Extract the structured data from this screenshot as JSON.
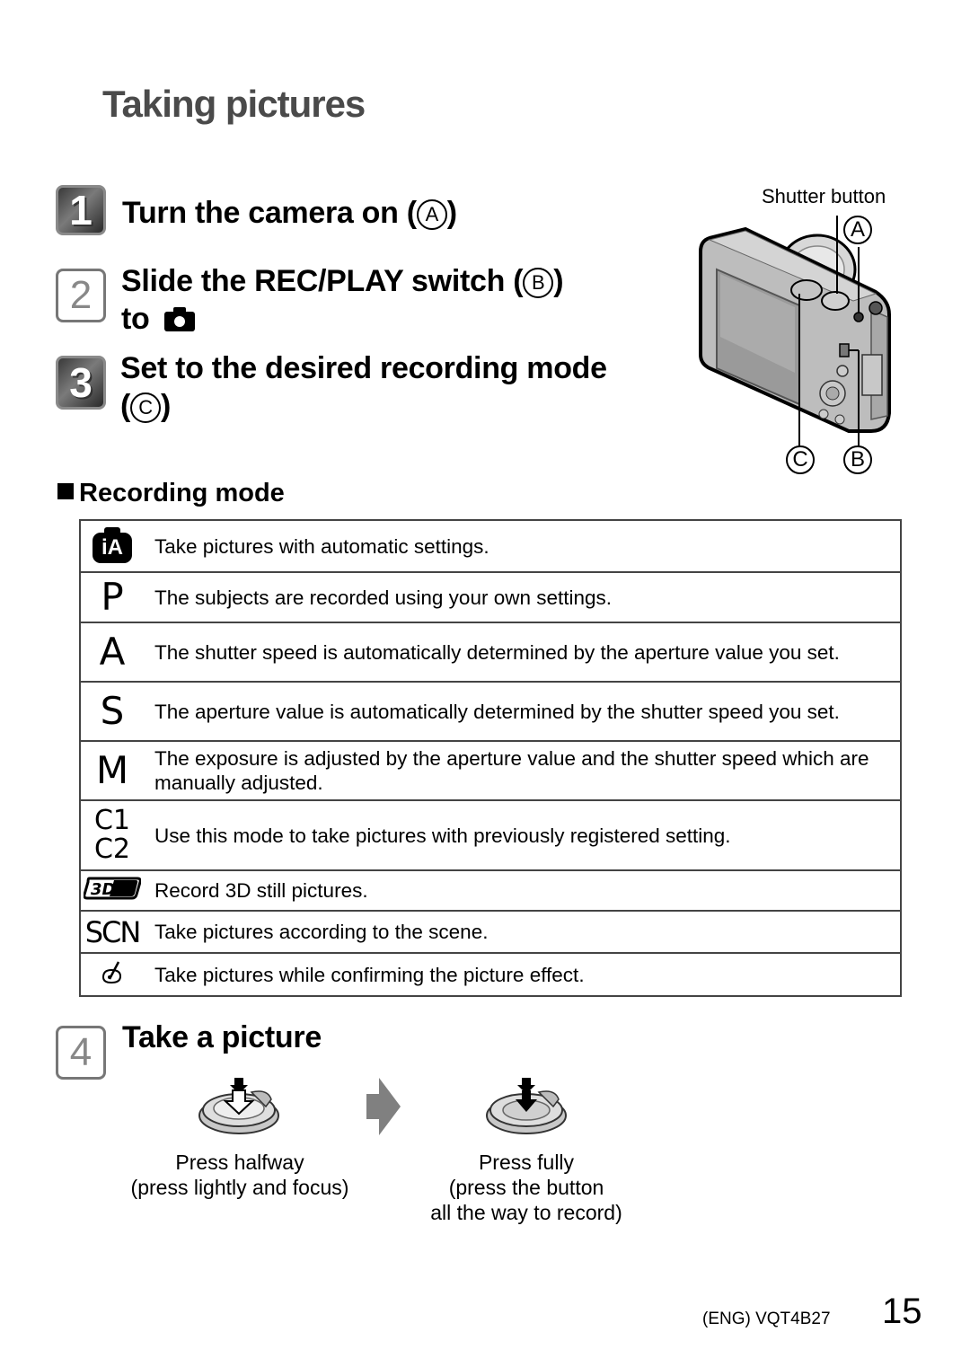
{
  "page_title": "Taking pictures",
  "steps": [
    {
      "number": "1",
      "line1": "Turn the camera on (",
      "marker": "A",
      "line1_end": ")"
    },
    {
      "number": "2",
      "line1": "Slide the REC/PLAY switch (",
      "marker": "B",
      "line1_end": ")",
      "line2": "to",
      "line2_icon": "camera-icon"
    },
    {
      "number": "3",
      "line1": "Set to the desired recording mode",
      "line2_open": "(",
      "marker": "C",
      "line2_end": ")"
    },
    {
      "number": "4",
      "line1": "Take a picture"
    }
  ],
  "camera_figure": {
    "shutter_label": "Shutter button",
    "markers": [
      "A",
      "B",
      "C"
    ]
  },
  "recording_mode": {
    "heading": "Recording mode",
    "rows": [
      {
        "icon": "intelligent-auto-icon",
        "glyph": "iA",
        "description": "Take pictures with automatic settings."
      },
      {
        "icon": "program-mode-icon",
        "glyph": "P",
        "description": "The subjects are recorded using your own settings."
      },
      {
        "icon": "aperture-priority-icon",
        "glyph": "A",
        "description": "The shutter speed is automatically determined by the aperture value you set."
      },
      {
        "icon": "shutter-priority-icon",
        "glyph": "S",
        "description": "The aperture value is automatically determined by the shutter speed you set."
      },
      {
        "icon": "manual-mode-icon",
        "glyph": "M",
        "description": "The exposure is adjusted by the aperture value and the shutter speed which are manually adjusted."
      },
      {
        "icon": "custom-mode-icon",
        "glyph": "C1 C2",
        "glyph_line1": "C1",
        "glyph_line2": "C2",
        "description": "Use this mode to take pictures with previously registered setting."
      },
      {
        "icon": "3d-mode-icon",
        "glyph": "3D",
        "description": "Record 3D still pictures."
      },
      {
        "icon": "scene-mode-icon",
        "glyph": "SCN",
        "description": "Take pictures according to the scene."
      },
      {
        "icon": "creative-control-icon",
        "glyph": "",
        "description": "Take pictures while confirming the picture effect."
      }
    ]
  },
  "take_picture": {
    "halfway": {
      "line1": "Press halfway",
      "line2": "(press lightly and focus)"
    },
    "fully": {
      "line1": "Press fully",
      "line2": "(press the button",
      "line3": "all the way to record)"
    }
  },
  "footer": {
    "code": "(ENG) VQT4B27",
    "page_number": "15"
  }
}
